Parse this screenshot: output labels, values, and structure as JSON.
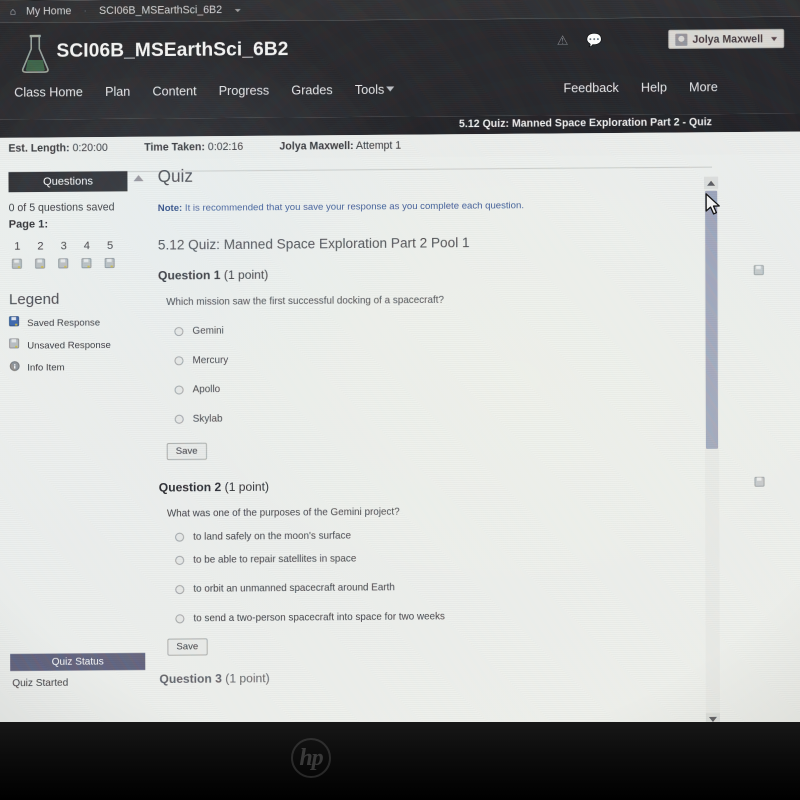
{
  "breadcrumb": {
    "home_label": "My Home",
    "home_icon": "home-icon",
    "course_label": "SCI06B_MSEarthSci_6B2"
  },
  "header": {
    "course_title": "SCI06B_MSEarthSci_6B2",
    "logo_icon": "flask-icon",
    "alert_icon": "alert-icon",
    "chat_icon": "chat-icon",
    "user_name": "Jolya Maxwell",
    "avatar_icon": "avatar-icon"
  },
  "nav": {
    "items": [
      {
        "label": "Class Home"
      },
      {
        "label": "Plan"
      },
      {
        "label": "Content"
      },
      {
        "label": "Progress"
      },
      {
        "label": "Grades"
      },
      {
        "label": "Tools"
      }
    ],
    "right_items": [
      {
        "label": "Feedback"
      },
      {
        "label": "Help"
      },
      {
        "label": "More"
      }
    ]
  },
  "quiz_bar": {
    "title": "5.12 Quiz: Manned Space Exploration Part 2 - Quiz"
  },
  "info_bar": {
    "est_length_label": "Est. Length:",
    "est_length_value": "0:20:00",
    "time_taken_label": "Time Taken:",
    "time_taken_value": "0:02:16",
    "attempt_user": "Jolya Maxwell:",
    "attempt_value": "Attempt 1"
  },
  "sidebar": {
    "questions_panel_title": "Questions",
    "saved_count": "0 of 5 questions saved",
    "page_label": "Page 1:",
    "question_numbers": [
      "1",
      "2",
      "3",
      "4",
      "5"
    ],
    "legend_title": "Legend",
    "legend": [
      {
        "label": "Saved Response",
        "icon": "saved-response-icon",
        "color": "#2f5fa8"
      },
      {
        "label": "Unsaved Response",
        "icon": "unsaved-response-icon",
        "color": "#a8acae"
      },
      {
        "label": "Info Item",
        "icon": "info-item-icon",
        "color": "#6d6f72"
      }
    ],
    "quiz_status_title": "Quiz Status",
    "quiz_status_value": "Quiz Started"
  },
  "main": {
    "heading": "Quiz",
    "note_label": "Note:",
    "note_text": " It is recommended that you save your response as you complete each question.",
    "pool_title": "5.12 Quiz: Manned Space Exploration Part 2 Pool 1",
    "save_label": "Save",
    "questions": [
      {
        "number": "Question 1",
        "points": "(1 point)",
        "text": "Which mission saw the first successful docking of a spacecraft?",
        "options": [
          "Gemini",
          "Mercury",
          "Apollo",
          "Skylab"
        ]
      },
      {
        "number": "Question 2",
        "points": "(1 point)",
        "text": "What was one of the purposes of the Gemini project?",
        "options": [
          "to land safely on the moon's surface",
          "to be able to repair satellites in space",
          "to orbit an unmanned spacecraft around Earth",
          "to send a two-person spacecraft into space for two weeks"
        ]
      },
      {
        "number": "Question 3",
        "points": "(1 point)",
        "text": "",
        "options": []
      }
    ]
  },
  "scrollbar": {
    "up_icon": "scroll-up-arrow-icon",
    "down_icon": "scroll-down-arrow-icon",
    "thumb": "scrollbar-thumb"
  },
  "device": {
    "brand_logo": "hp-logo"
  },
  "colors": {
    "nav_dark": "#1b1b20",
    "panel_header": "#1d1d22",
    "quiz_status_header": "#5a5c78",
    "note_blue": "#2f4e8f",
    "page_bg": "#eef0ee"
  }
}
